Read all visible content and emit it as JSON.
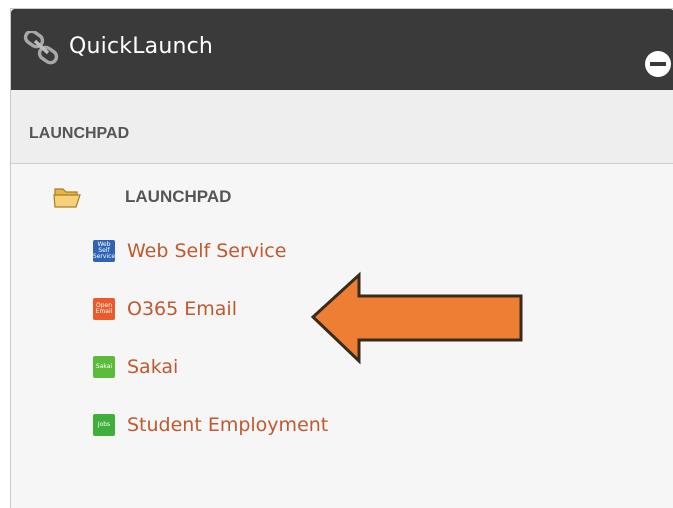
{
  "widget": {
    "title": "QuickLaunch",
    "header_icon": "chain-link-icon",
    "collapse_icon": "minus-circle-icon"
  },
  "section": {
    "label": "LAUNCHPAD"
  },
  "folder": {
    "label": "LAUNCHPAD",
    "icon": "open-folder-icon"
  },
  "apps": [
    {
      "label": "Web Self Service",
      "icon_text": "Web Self Service",
      "icon_color": "#2f63b6"
    },
    {
      "label": "O365 Email",
      "icon_text": "Open Email",
      "icon_color": "#ea5a2a"
    },
    {
      "label": "Sakai",
      "icon_text": "Sakai",
      "icon_color": "#5dbb3c"
    },
    {
      "label": "Student Employment",
      "icon_text": "Jobs",
      "icon_color": "#3fae3a"
    }
  ],
  "annotation": {
    "arrow_color": "#ee7e33",
    "arrow_outline": "#3a2a1a"
  },
  "colors": {
    "header_bg": "#3a3a3a",
    "link": "#c2582f",
    "section_text": "#555555"
  }
}
